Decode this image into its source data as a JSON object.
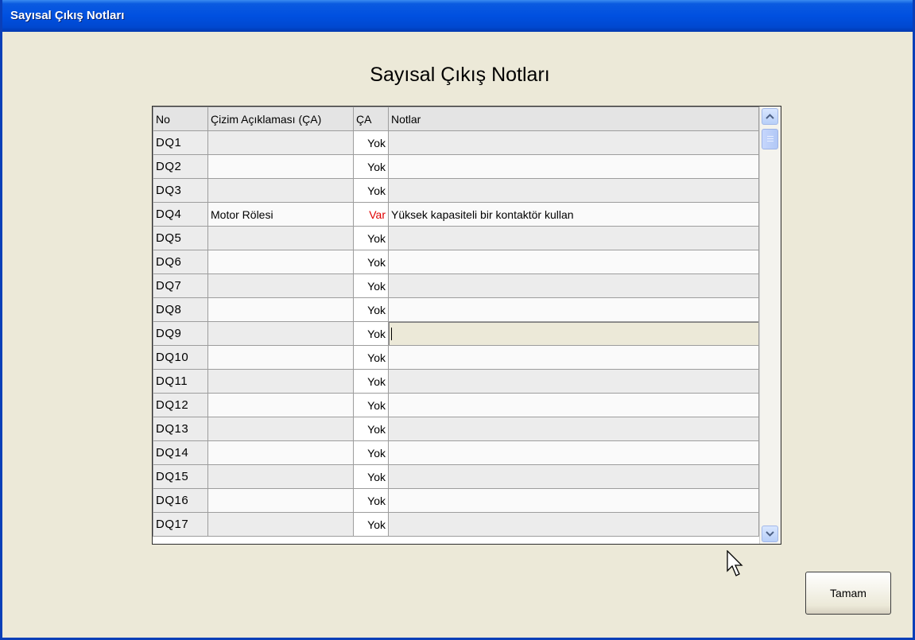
{
  "window": {
    "title": "Sayısal Çıkış Notları"
  },
  "heading": "Sayısal Çıkış Notları",
  "table": {
    "columns": [
      "No",
      "Çizim Açıklaması (ÇA)",
      "ÇA",
      "Notlar"
    ],
    "rows": [
      {
        "no": "DQ1",
        "desc": "",
        "ca": "Yok",
        "notes": ""
      },
      {
        "no": "DQ2",
        "desc": "",
        "ca": "Yok",
        "notes": ""
      },
      {
        "no": "DQ3",
        "desc": "",
        "ca": "Yok",
        "notes": ""
      },
      {
        "no": "DQ4",
        "desc": "Motor Rölesi",
        "ca": "Var",
        "notes": "Yüksek kapasiteli bir kontaktör kullan"
      },
      {
        "no": "DQ5",
        "desc": "",
        "ca": "Yok",
        "notes": ""
      },
      {
        "no": "DQ6",
        "desc": "",
        "ca": "Yok",
        "notes": ""
      },
      {
        "no": "DQ7",
        "desc": "",
        "ca": "Yok",
        "notes": ""
      },
      {
        "no": "DQ8",
        "desc": "",
        "ca": "Yok",
        "notes": ""
      },
      {
        "no": "DQ9",
        "desc": "",
        "ca": "Yok",
        "notes": ""
      },
      {
        "no": "DQ10",
        "desc": "",
        "ca": "Yok",
        "notes": ""
      },
      {
        "no": "DQ11",
        "desc": "",
        "ca": "Yok",
        "notes": ""
      },
      {
        "no": "DQ12",
        "desc": "",
        "ca": "Yok",
        "notes": ""
      },
      {
        "no": "DQ13",
        "desc": "",
        "ca": "Yok",
        "notes": ""
      },
      {
        "no": "DQ14",
        "desc": "",
        "ca": "Yok",
        "notes": ""
      },
      {
        "no": "DQ15",
        "desc": "",
        "ca": "Yok",
        "notes": ""
      },
      {
        "no": "DQ16",
        "desc": "",
        "ca": "Yok",
        "notes": ""
      },
      {
        "no": "DQ17",
        "desc": "",
        "ca": "Yok",
        "notes": ""
      }
    ],
    "editing_row": "DQ9",
    "highlight_value": "Var",
    "highlight_color": "#e00000"
  },
  "buttons": {
    "ok": "Tamam"
  },
  "colors": {
    "titlebar": "#0050e0",
    "background": "#ece9d8"
  }
}
